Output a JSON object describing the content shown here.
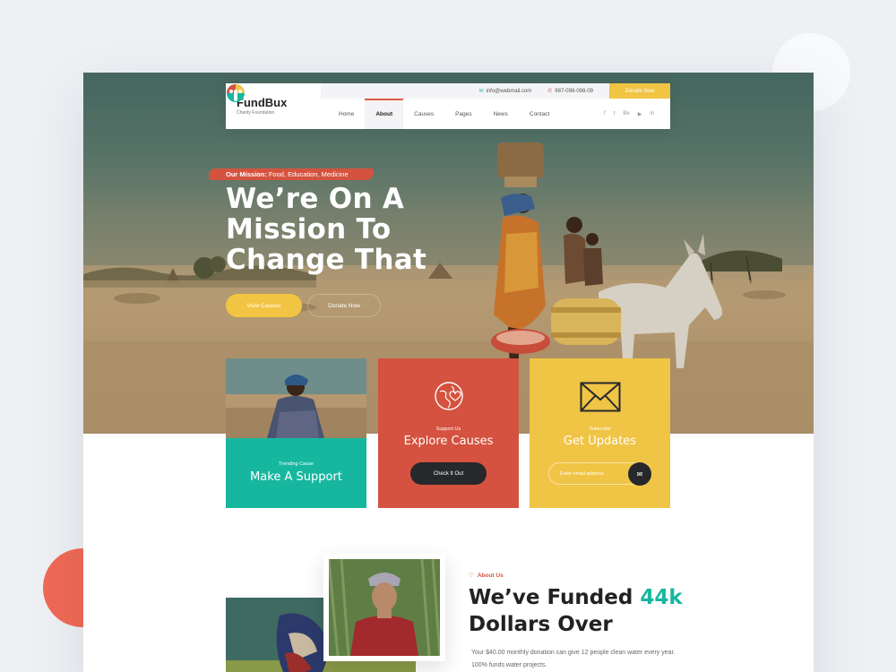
{
  "brand": {
    "name": "FundBux",
    "tagline": "Charity Foundation"
  },
  "topbar": {
    "email": "info@webmail.com",
    "phone": "987-098-098-09",
    "donate_label": "Donate Now"
  },
  "nav": {
    "items": [
      {
        "label": "Home",
        "active": false
      },
      {
        "label": "About",
        "active": true
      },
      {
        "label": "Causes",
        "active": false
      },
      {
        "label": "Pages",
        "active": false
      },
      {
        "label": "News",
        "active": false
      },
      {
        "label": "Contact",
        "active": false
      }
    ],
    "socials": [
      "f",
      "t",
      "Be",
      "▶",
      "in"
    ]
  },
  "hero": {
    "mission_prefix": "Our Mission:",
    "mission_text": "Food, Education, Medicine",
    "title": "We’re On A Mission To Change That",
    "primary_button": "View Causes",
    "secondary_button": "Donate Now"
  },
  "cards": {
    "trending": {
      "small": "Trending Cause",
      "title": "Make A Support"
    },
    "explore": {
      "small": "Support Us",
      "title": "Explore Causes",
      "button": "Check It Out"
    },
    "subscribe": {
      "small": "Subscribe",
      "title": "Get Updates",
      "placeholder": "Enter email address"
    }
  },
  "about": {
    "tag": "About Us",
    "title_part1": "We’ve Funded",
    "title_accent": "44k",
    "title_part2": "Dollars Over",
    "text": "Your $40.00 monthly donation can give 12 people clean water every year. 100% funds water projects."
  },
  "colors": {
    "teal": "#17b79f",
    "red": "#d4523f",
    "yellow": "#f1c444",
    "dark": "#26282c"
  }
}
